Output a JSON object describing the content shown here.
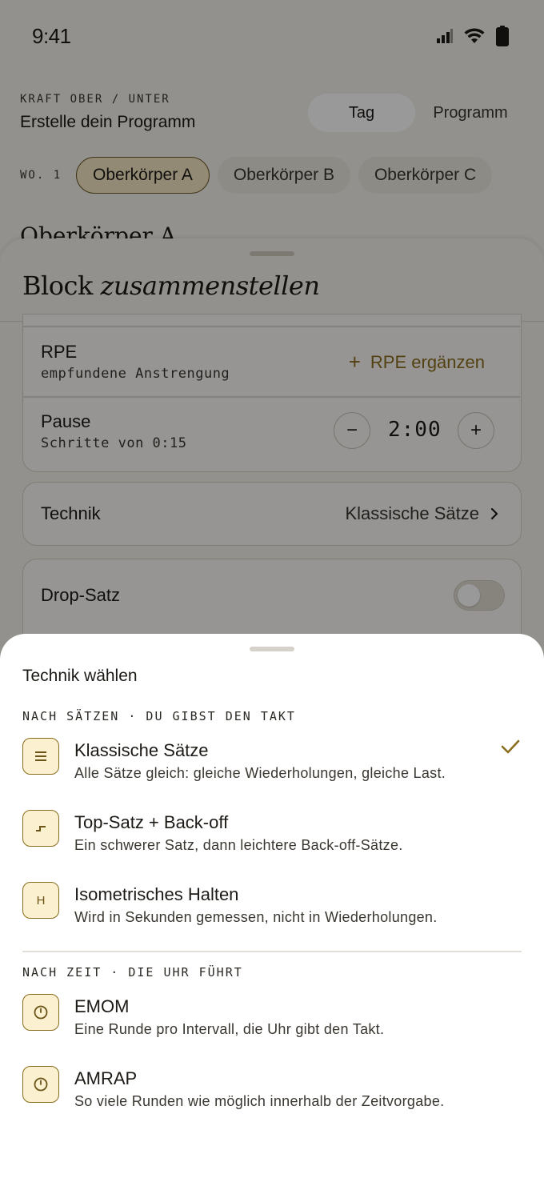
{
  "status_bar": {
    "time": "9:41"
  },
  "header": {
    "eyebrow": "KRAFT OBER / UNTER",
    "title": "Erstelle dein Programm",
    "segments": [
      "Tag",
      "Programm"
    ]
  },
  "days": {
    "week_label": "WO. 1",
    "chips": [
      "Oberkörper A",
      "Oberkörper B",
      "Oberkörper C"
    ]
  },
  "background_heading": "Oberkörper A",
  "block_sheet": {
    "title_regular": "Block",
    "title_italic": "zusammenstellen",
    "rpe": {
      "label": "RPE",
      "sub": "empfundene Anstrengung",
      "add_label": "RPE ergänzen"
    },
    "pause": {
      "label": "Pause",
      "sub": "Schritte von 0:15",
      "value": "2:00",
      "minus": "−",
      "plus": "+"
    },
    "technik": {
      "label": "Technik",
      "value": "Klassische Sätze"
    },
    "drop_satz": {
      "label": "Drop-Satz",
      "enabled": false
    }
  },
  "technik_sheet": {
    "title": "Technik wählen",
    "section_sets": "NACH SÄTZEN · DU GIBST DEN TAKT",
    "section_time": "NACH ZEIT · DIE UHR FÜHRT",
    "options": [
      {
        "icon": "lines-icon",
        "icon_text": "≡",
        "title": "Klassische Sätze",
        "desc": "Alle Sätze gleich: gleiche Wiederholungen, gleiche Last.",
        "selected": true
      },
      {
        "icon": "step-down-icon",
        "icon_text": "",
        "title": "Top-Satz + Back-off",
        "desc": "Ein schwerer Satz, dann leichtere Back-off-Sätze.",
        "selected": false
      },
      {
        "icon": "hold-letter-icon",
        "icon_text": "H",
        "title": "Isometrisches Halten",
        "desc": "Wird in Sekunden gemessen, nicht in Wiederholungen.",
        "selected": false
      },
      {
        "icon": "timer-icon",
        "icon_text": "",
        "title": "EMOM",
        "desc": "Eine Runde pro Intervall, die Uhr gibt den Takt.",
        "selected": false
      },
      {
        "icon": "timer-icon",
        "icon_text": "",
        "title": "AMRAP",
        "desc": "So viele Runden wie möglich innerhalb der Zeitvorgabe.",
        "selected": false
      }
    ]
  },
  "colors": {
    "accent": "#8a6d1f",
    "accent_bg": "#fbf0cf",
    "scrim": "rgba(0,0,0,0.40)"
  }
}
